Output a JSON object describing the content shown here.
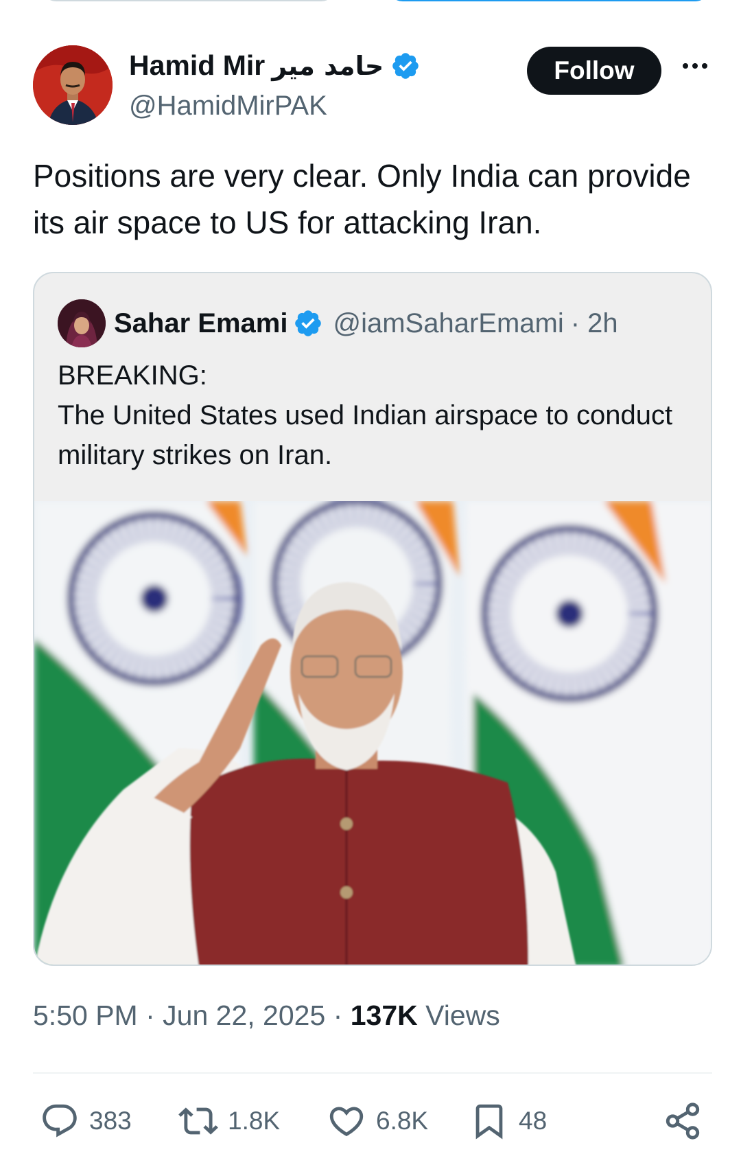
{
  "tweet": {
    "author": {
      "display_name": "Hamid Mir",
      "urdu_name": "حامد میر",
      "handle": "@HamidMirPAK",
      "verified": true
    },
    "follow_label": "Follow",
    "text": "Positions are very clear. Only India can provide its air space to US for attacking Iran.",
    "quote": {
      "author_name": "Sahar Emami",
      "handle": "@iamSaharEmami",
      "time": "· 2h",
      "verified": true,
      "text_line1": "BREAKING:",
      "text_line2": "The United States used Indian airspace to conduct military strikes on Iran."
    },
    "meta": {
      "time": "5:50 PM",
      "separator": "·",
      "date": "Jun 22, 2025",
      "views_count": "137K",
      "views_label": "Views"
    },
    "actions": {
      "replies": "383",
      "reposts": "1.8K",
      "likes": "6.8K",
      "bookmarks": "48"
    }
  },
  "icons": {
    "verified": "verified-badge-icon",
    "more": "more-icon",
    "reply": "reply-icon",
    "repost": "repost-icon",
    "like": "heart-icon",
    "bookmark": "bookmark-icon",
    "share": "share-icon"
  },
  "colors": {
    "verified_blue": "#1d9bf0",
    "text_primary": "#0f1419",
    "text_secondary": "#536471",
    "follow_bg": "#0f1419"
  }
}
